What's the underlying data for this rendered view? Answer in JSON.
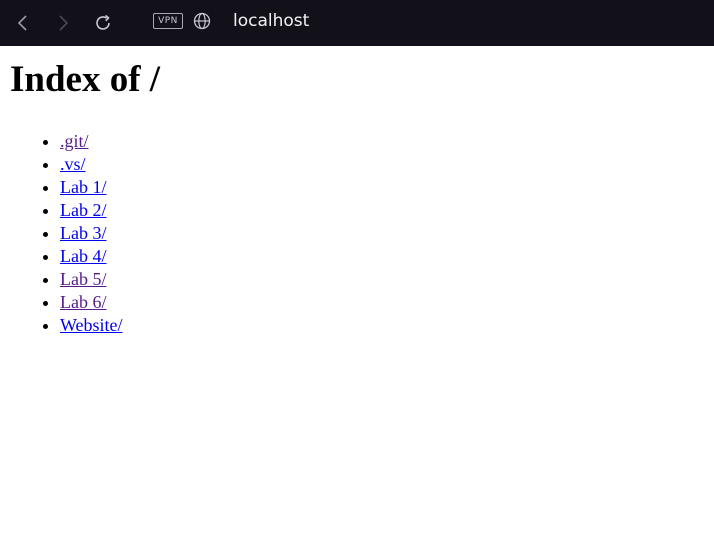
{
  "browser": {
    "vpn_label": "VPN",
    "address": "localhost",
    "icons": {
      "back": "chevron-left-icon",
      "forward": "chevron-right-icon",
      "reload": "reload-icon",
      "site": "globe-icon"
    }
  },
  "page": {
    "title": "Index of /",
    "entries": [
      {
        "label": ".git/",
        "visited": true
      },
      {
        "label": ".vs/",
        "visited": false
      },
      {
        "label": "Lab 1/",
        "visited": false
      },
      {
        "label": "Lab 2/",
        "visited": false
      },
      {
        "label": "Lab 3/",
        "visited": false
      },
      {
        "label": "Lab 4/",
        "visited": false
      },
      {
        "label": "Lab 5/",
        "visited": true
      },
      {
        "label": "Lab 6/",
        "visited": true
      },
      {
        "label": "Website/",
        "visited": false
      }
    ]
  },
  "colors": {
    "toolbar_bg": "#12111a",
    "link": "#0000ee",
    "link_visited": "#551a8b"
  }
}
